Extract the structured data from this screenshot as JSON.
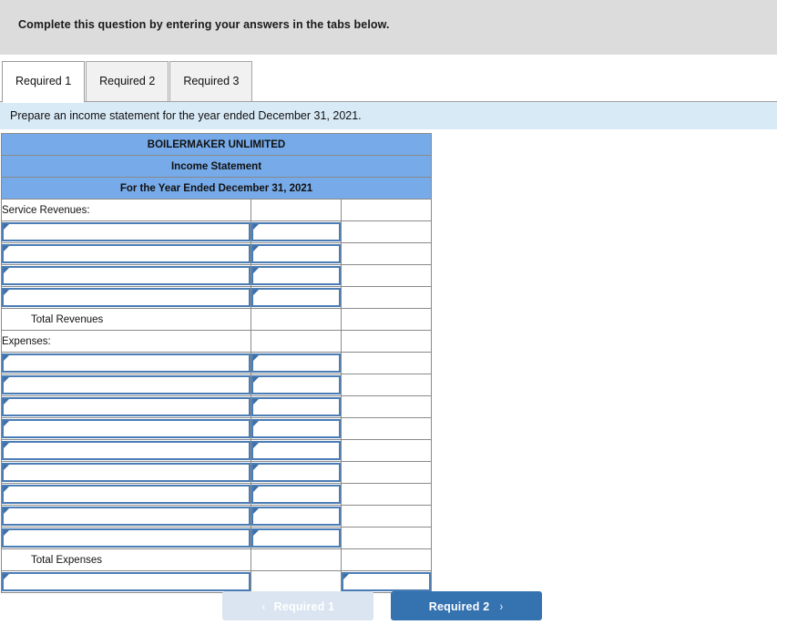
{
  "banner": {
    "text": "Complete this question by entering your answers in the tabs below."
  },
  "tabs": [
    {
      "label": "Required 1",
      "active": true
    },
    {
      "label": "Required 2",
      "active": false
    },
    {
      "label": "Required 3",
      "active": false
    }
  ],
  "prompt": {
    "text": "Prepare an income statement for the year ended December 31, 2021."
  },
  "worksheet": {
    "title_lines": [
      "BOILERMAKER UNLIMITED",
      "Income Statement",
      "For the Year Ended December 31, 2021"
    ],
    "section_revenues_label": "Service Revenues:",
    "total_revenues_label": "Total Revenues",
    "section_expenses_label": "Expenses:",
    "total_expenses_label": "Total Expenses",
    "revenue_rows": [
      {
        "label": "",
        "amount": ""
      },
      {
        "label": "",
        "amount": ""
      },
      {
        "label": "",
        "amount": ""
      },
      {
        "label": "",
        "amount": ""
      }
    ],
    "expense_rows": [
      {
        "label": "",
        "amount": ""
      },
      {
        "label": "",
        "amount": ""
      },
      {
        "label": "",
        "amount": ""
      },
      {
        "label": "",
        "amount": ""
      },
      {
        "label": "",
        "amount": ""
      },
      {
        "label": "",
        "amount": ""
      },
      {
        "label": "",
        "amount": ""
      },
      {
        "label": "",
        "amount": ""
      },
      {
        "label": "",
        "amount": ""
      }
    ],
    "net_row": {
      "label": "",
      "amount": ""
    },
    "total_revenues_value": "",
    "total_expenses_value": ""
  },
  "nav": {
    "prev_label": "Required 1",
    "prev_icon": "chevron-left-icon",
    "prev_chevron": "‹",
    "next_label": "Required 2",
    "next_icon": "chevron-right-icon",
    "next_chevron": "›"
  },
  "colors": {
    "banner_bg": "#dcdcdc",
    "prompt_bg": "#d9eaf7",
    "table_header_bg": "#77aae8",
    "input_border": "#4a7cb5",
    "btn_active_bg": "#3572b0",
    "btn_disabled_bg": "#dbe5f1"
  }
}
